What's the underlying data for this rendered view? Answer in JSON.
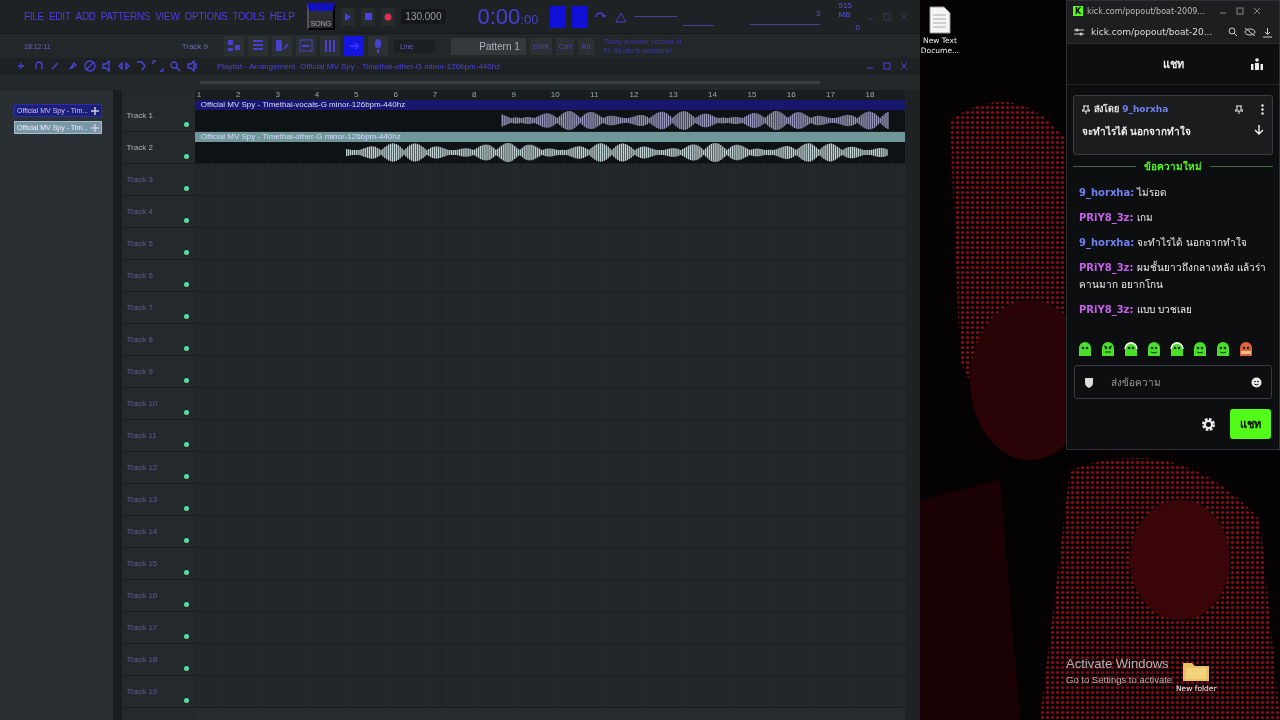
{
  "fl": {
    "menu": [
      "FILE",
      "EDIT",
      "ADD",
      "PATTERNS",
      "VIEW",
      "OPTIONS",
      "TOOLS",
      "HELP"
    ],
    "song_mode": {
      "label": "SONG",
      "selected": true
    },
    "tempo": "130.000",
    "time": {
      "main": "0:00",
      "sub": ":00"
    },
    "cpu": "3",
    "memory": "515 MB",
    "polyphony": "0",
    "clock": "18:12:11",
    "hint_track": "Track 9",
    "tools": [
      {
        "kind": "grid",
        "on": false
      },
      {
        "kind": "list",
        "on": false
      },
      {
        "kind": "rack",
        "on": false
      },
      {
        "kind": "roll",
        "on": false
      },
      {
        "kind": "mixer",
        "on": false
      },
      {
        "kind": "plug",
        "on": true
      },
      {
        "kind": "mic",
        "on": false
      }
    ],
    "snap": "Line",
    "pattern": "Pattern 1",
    "keys": [
      "Shift",
      "Ctrl",
      "Alt"
    ],
    "news": [
      "Today  A newer version of",
      "FL Studio is available!"
    ],
    "playlist_title": [
      "Playlist - Arrangement",
      "Official MV  Spy - Timethai-other-G minor-126bpm-440hz"
    ],
    "picker": [
      {
        "label": "Official MV  Spy - Tim...",
        "selected": false
      },
      {
        "label": "Official MV  Spy - Tim...",
        "selected": true
      }
    ],
    "ruler": [
      "1",
      "2",
      "3",
      "4",
      "5",
      "6",
      "7",
      "8",
      "9",
      "10",
      "11",
      "12",
      "13",
      "14",
      "15",
      "16",
      "17",
      "18"
    ],
    "tracks": [
      {
        "name": "Track 1",
        "clip": {
          "label": "Official MV  Spy - Timethai-vocals-G minor-126bpm-440hz",
          "color": "#17176e"
        }
      },
      {
        "name": "Track 2",
        "clip": {
          "label": "Official MV  Spy - Timethai-other-G minor-126bpm-440hz",
          "color": "#6f9799"
        }
      },
      {
        "name": "Track 3"
      },
      {
        "name": "Track 4"
      },
      {
        "name": "Track 5"
      },
      {
        "name": "Track 6"
      },
      {
        "name": "Track 7"
      },
      {
        "name": "Track 8"
      },
      {
        "name": "Track 9"
      },
      {
        "name": "Track 10"
      },
      {
        "name": "Track 11"
      },
      {
        "name": "Track 12"
      },
      {
        "name": "Track 13"
      },
      {
        "name": "Track 14"
      },
      {
        "name": "Track 15"
      },
      {
        "name": "Track 16"
      },
      {
        "name": "Track 17"
      },
      {
        "name": "Track 18"
      },
      {
        "name": "Track 19"
      }
    ]
  },
  "desktop": {
    "icons": [
      {
        "label": "New Text Docume...",
        "kind": "document"
      }
    ],
    "activation": {
      "title": "Activate Windows",
      "text": "Go to Settings to activate"
    },
    "overlay_icon": {
      "label": "New folder",
      "kind": "folder"
    }
  },
  "chat": {
    "logo": "K",
    "window_title": "kick.com/popout/boat-2009...",
    "address": "kick.com/popout/boat-20...",
    "header": "แชท",
    "pinned": {
      "prefix": "ส่งโดย",
      "user": "9_horxha",
      "text": "จะทำไรได้ นอกจากทำใจ"
    },
    "divider": "ข้อความใหม่",
    "messages": [
      {
        "user": "9_horxha:",
        "color": "#7080f0",
        "text": "ไม่รอด"
      },
      {
        "user": "PRiY8_3z:",
        "color": "#c462e8",
        "text": "เกม"
      },
      {
        "user": "9_horxha:",
        "color": "#7080f0",
        "text": "จะทำไรได้ นอกจากทำใจ"
      },
      {
        "user": "PRiY8_3z:",
        "color": "#c462e8",
        "text": "ผมชั้นยาวถึงกลางหลัง แล้วร่าคานมาก อยากโกน"
      },
      {
        "user": "PRiY8_3z:",
        "color": "#c462e8",
        "text": "แบบ บวชเลย"
      }
    ],
    "emotes": [
      {
        "kind": "ghost"
      },
      {
        "kind": "angry"
      },
      {
        "kind": "headset"
      },
      {
        "kind": "smile"
      },
      {
        "kind": "headset"
      },
      {
        "kind": "smile"
      },
      {
        "kind": "smile"
      },
      {
        "kind": "dog"
      }
    ],
    "placeholder": "ส่งข้อความ",
    "send": "แชท"
  }
}
